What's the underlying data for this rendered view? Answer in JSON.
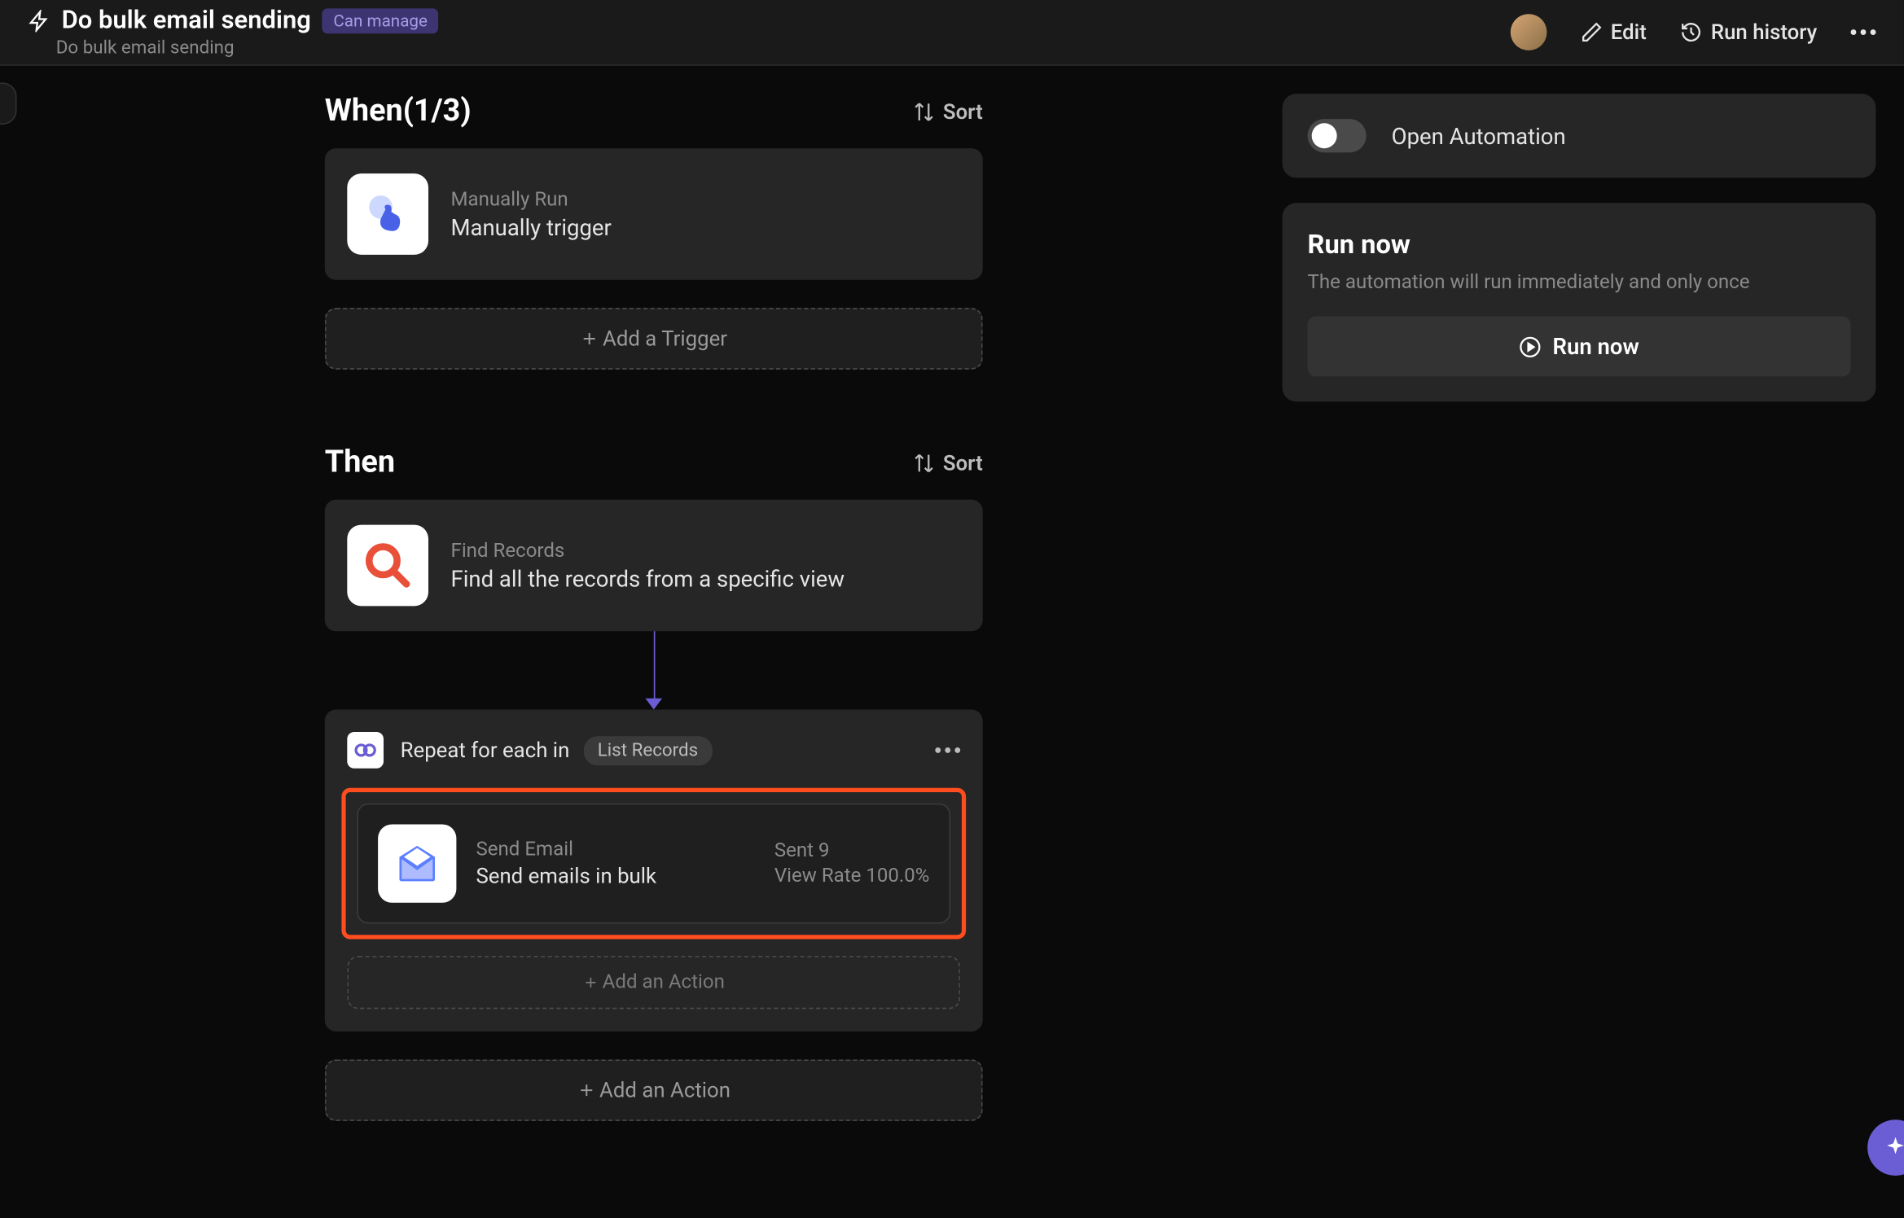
{
  "header": {
    "title": "Do bulk email sending",
    "badge": "Can manage",
    "subtitle": "Do bulk email sending",
    "edit": "Edit",
    "history": "Run history"
  },
  "when": {
    "title": "When(1/3)",
    "sort": "Sort",
    "trigger": {
      "label": "Manually Run",
      "desc": "Manually trigger"
    },
    "add": "Add a Trigger"
  },
  "then": {
    "title": "Then",
    "sort": "Sort",
    "find": {
      "label": "Find Records",
      "desc": "Find all the records from a specific view"
    },
    "loop": {
      "title": "Repeat for each in",
      "pill": "List Records",
      "email": {
        "label": "Send Email",
        "desc": "Send emails in bulk",
        "stat1": "Sent 9",
        "stat2": "View Rate 100.0%"
      },
      "add_inner": "Add an Action"
    },
    "add": "Add an Action"
  },
  "right": {
    "toggle_label": "Open Automation",
    "run_title": "Run now",
    "run_desc": "The automation will run immediately and only once",
    "run_btn": "Run now"
  }
}
